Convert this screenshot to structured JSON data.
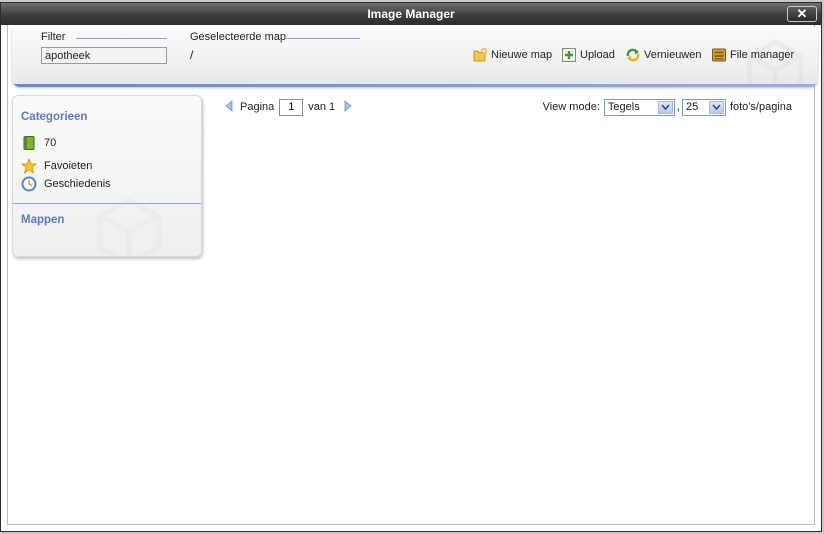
{
  "window": {
    "title": "Image Manager",
    "close_label": "✕"
  },
  "toolbar": {
    "filter_label": "Filter",
    "filter_value": "apotheek",
    "selected_folder_label": "Geselecteerde map",
    "selected_folder_value": "/",
    "buttons": {
      "new_folder": "Nieuwe map",
      "upload": "Upload",
      "refresh": "Vernieuwen",
      "file_manager": "File manager"
    }
  },
  "sidebar": {
    "categories_title": "Categorieen",
    "items": [
      {
        "label": "70",
        "icon": "book-icon"
      },
      {
        "label": "Favoieten",
        "icon": "star-icon"
      },
      {
        "label": "Geschiedenis",
        "icon": "clock-icon"
      }
    ],
    "folders_title": "Mappen"
  },
  "pager": {
    "page_label": "Pagina",
    "page_value": "1",
    "of_label": "van 1"
  },
  "view": {
    "mode_label": "View mode:",
    "mode_value": "Tegels",
    "per_page_value": "25",
    "per_page_suffix": "foto's/pagina"
  },
  "colors": {
    "accent": "#6079b8",
    "titlebar": "#3e3e3e"
  }
}
